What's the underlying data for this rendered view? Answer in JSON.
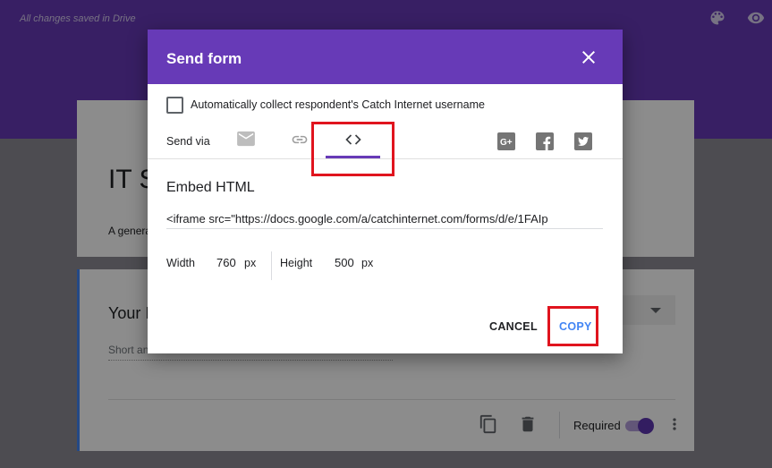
{
  "header": {
    "saved_status": "All changes saved in Drive",
    "icons": [
      "palette-icon",
      "eye-icon"
    ]
  },
  "form": {
    "title": "IT S",
    "description": "A genera",
    "question": {
      "title": "Your I",
      "placeholder": "Short an",
      "required_label": "Required",
      "required": true
    }
  },
  "dialog": {
    "title": "Send form",
    "collect_label": "Automatically collect respondent's Catch Internet username",
    "collect_checked": false,
    "send_via_label": "Send via",
    "tabs": [
      {
        "icon": "email-icon",
        "selected": false
      },
      {
        "icon": "link-icon",
        "selected": false
      },
      {
        "icon": "embed-code-icon",
        "selected": true
      }
    ],
    "share": [
      "google-plus-icon",
      "facebook-icon",
      "twitter-icon"
    ],
    "embed": {
      "title": "Embed HTML",
      "code": "<iframe src=\"https://docs.google.com/a/catchinternet.com/forms/d/e/1FAIp",
      "width_label": "Width",
      "width_value": "760",
      "height_label": "Height",
      "height_value": "500",
      "unit": "px"
    },
    "buttons": {
      "cancel": "CANCEL",
      "copy": "COPY"
    }
  },
  "colors": {
    "brand": "#673ab7",
    "link": "#4285f4",
    "highlight": "#e0141e"
  }
}
